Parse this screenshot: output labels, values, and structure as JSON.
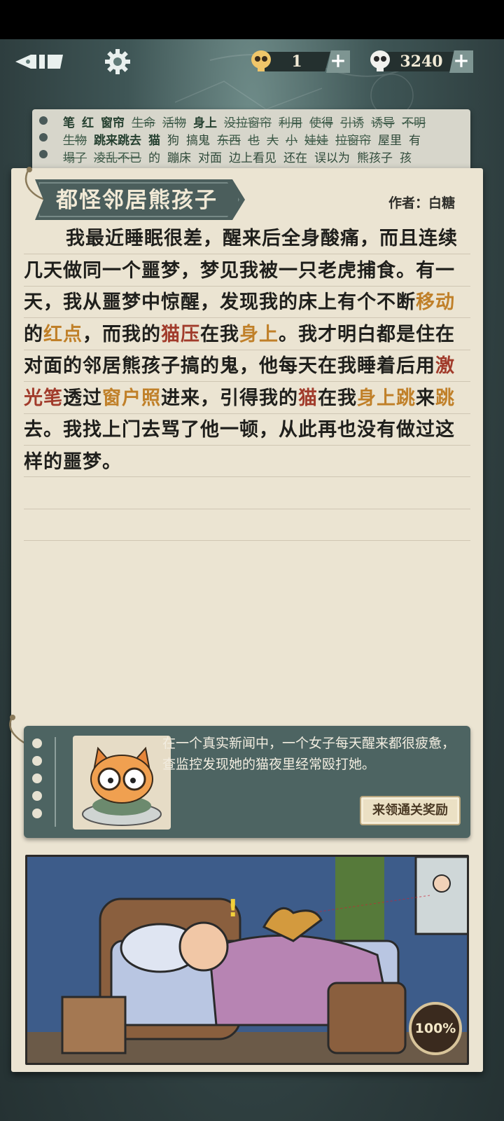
{
  "header": {
    "back_icon": "pen-nib-back-icon",
    "settings_icon": "gear-icon",
    "currency1": {
      "icon": "skull-coin-icon",
      "value": "1",
      "plus": "+"
    },
    "currency2": {
      "icon": "skull-coin-icon",
      "value": "3240",
      "plus": "+"
    }
  },
  "word_bank": {
    "rows": [
      [
        {
          "t": "笔",
          "c": "b"
        },
        {
          "t": "红",
          "c": "b"
        },
        {
          "t": "窗帘",
          "c": "b"
        },
        {
          "t": "生命",
          "c": "s"
        },
        {
          "t": "活物",
          "c": "s"
        },
        {
          "t": "身上",
          "c": "b"
        },
        {
          "t": "没拉窗帘",
          "c": "s"
        },
        {
          "t": "利用",
          "c": "s"
        },
        {
          "t": "使得",
          "c": "s"
        },
        {
          "t": "引诱",
          "c": "s"
        },
        {
          "t": "诱导",
          "c": "s"
        },
        {
          "t": "不明",
          "c": "s"
        }
      ],
      [
        {
          "t": "生物",
          "c": "s"
        },
        {
          "t": "跳来跳去",
          "c": "b"
        },
        {
          "t": "猫",
          "c": "b"
        },
        {
          "t": "狗",
          "c": ""
        },
        {
          "t": "搞鬼",
          "c": ""
        },
        {
          "t": "东西",
          "c": "s"
        },
        {
          "t": "也",
          "c": "s"
        },
        {
          "t": "大",
          "c": "s"
        },
        {
          "t": "小",
          "c": "s"
        },
        {
          "t": "娃娃",
          "c": "s"
        },
        {
          "t": "拉窗帘",
          "c": "s"
        },
        {
          "t": "屋里",
          "c": ""
        },
        {
          "t": "有",
          "c": ""
        }
      ],
      [
        {
          "t": "塌了",
          "c": "s"
        },
        {
          "t": "凌乱不已",
          "c": "s"
        },
        {
          "t": "的",
          "c": ""
        },
        {
          "t": "蹦床",
          "c": ""
        },
        {
          "t": "对面",
          "c": ""
        },
        {
          "t": "边上看见",
          "c": ""
        },
        {
          "t": "还在",
          "c": ""
        },
        {
          "t": "误以为",
          "c": ""
        },
        {
          "t": "熊孩子",
          "c": ""
        },
        {
          "t": "孩",
          "c": ""
        }
      ]
    ]
  },
  "story": {
    "title": "都怪邻居熊孩子",
    "author": "作者：白糖",
    "segments": [
      {
        "t": "我最近睡眠很差，醒来后全身酸痛，而且连续几天做同一个噩梦，梦见我被一只老虎捕食。有一天，我从噩梦中惊醒，发现我的床上有个不断",
        "c": ""
      },
      {
        "t": "移动",
        "c": "o"
      },
      {
        "t": "的",
        "c": ""
      },
      {
        "t": "红点",
        "c": "o"
      },
      {
        "t": "，而我的",
        "c": ""
      },
      {
        "t": "猫压",
        "c": "r"
      },
      {
        "t": "在我",
        "c": ""
      },
      {
        "t": "身上",
        "c": "o"
      },
      {
        "t": "。我才明白都是住在对面的邻居熊孩子搞的鬼，他每天在我睡着后用",
        "c": ""
      },
      {
        "t": "激光笔",
        "c": "r"
      },
      {
        "t": "透过",
        "c": ""
      },
      {
        "t": "窗户照",
        "c": "o"
      },
      {
        "t": "进来，引得我的",
        "c": ""
      },
      {
        "t": "猫",
        "c": "r"
      },
      {
        "t": "在我",
        "c": ""
      },
      {
        "t": "身上跳",
        "c": "o"
      },
      {
        "t": "来",
        "c": ""
      },
      {
        "t": "跳",
        "c": "o"
      },
      {
        "t": "去。我找上门去骂了他一顿，从此再也没有做过这样的噩梦。",
        "c": ""
      }
    ]
  },
  "hint": {
    "portrait_icon": "cat-with-glasses-icon",
    "text": "在一个真实新闻中，一个女子每天醒来都很疲惫，查监控发现她的猫夜里经常殴打她。",
    "reward_label": "来领通关奖励"
  },
  "illustration": {
    "description_icon": "sleeping-man-cat-laser-illustration",
    "progress_badge": "100%",
    "progress": 1.0
  },
  "colors": {
    "paper": "#ebe4d2",
    "banner": "#4b5e5c",
    "highlight_red": "#a13b2b",
    "highlight_orange": "#c08029",
    "card": "#4d6462"
  }
}
